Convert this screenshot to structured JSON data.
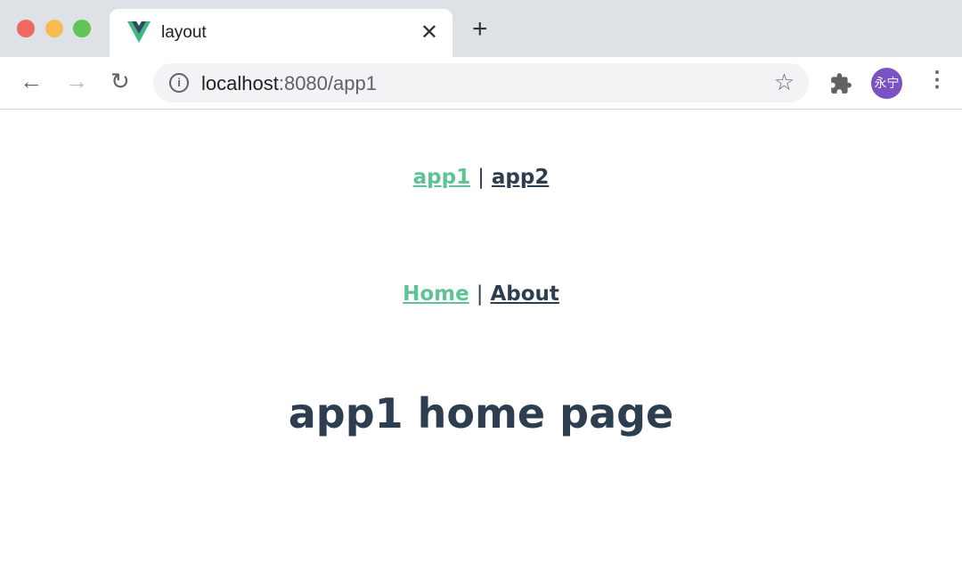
{
  "browser": {
    "tab_title": "layout",
    "url_host": "localhost",
    "url_rest": ":8080/app1",
    "avatar_text": "永宁"
  },
  "app_nav": {
    "items": [
      {
        "label": "app1",
        "active": true
      },
      {
        "label": "app2",
        "active": false
      }
    ],
    "separator": "|"
  },
  "page_nav": {
    "items": [
      {
        "label": "Home",
        "active": true
      },
      {
        "label": "About",
        "active": false
      }
    ],
    "separator": "|"
  },
  "heading": "app1 home page",
  "colors": {
    "active_link": "#42b983",
    "text": "#2c3e50",
    "avatar": "#7b52c4"
  }
}
